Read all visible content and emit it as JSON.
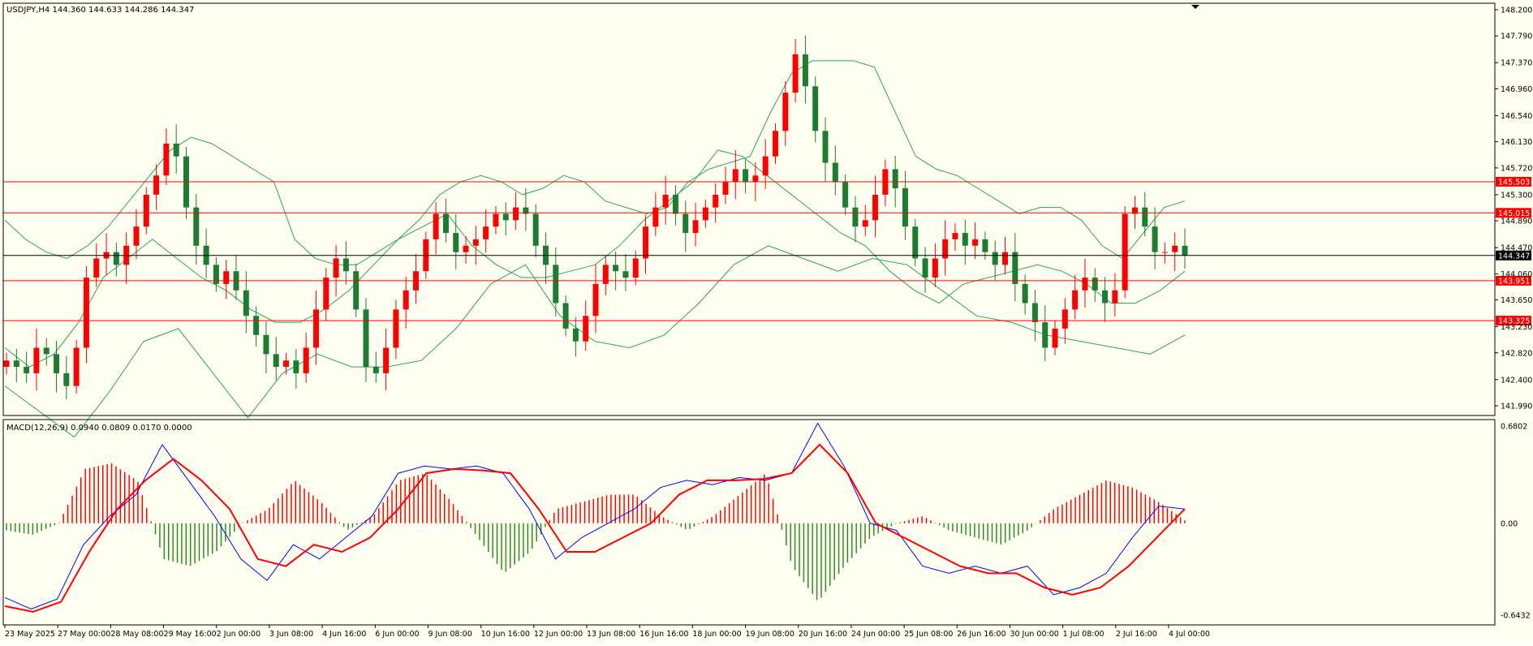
{
  "header": {
    "symbol_text": "USDJPY,H4  144.360 144.633 144.286 144.347",
    "macd_text": "MACD(12,26,9) 0.0940 0.0809 0.0170 0.0000"
  },
  "colors": {
    "background": "#fefff0",
    "bull": "#ff0000",
    "bear": "#1e7b32",
    "bollinger": "#2ca35a",
    "hline": "#ff0000",
    "current": "#000000",
    "macd_main": "#0000ff",
    "macd_signal": "#ff0000",
    "hist_up": "#ff0000",
    "hist_down": "#2e8b24"
  },
  "chart_data": [
    {
      "type": "candlestick",
      "symbol": "USDJPY",
      "timeframe": "H4",
      "ohlc_header": {
        "open": 144.36,
        "high": 144.633,
        "low": 144.286,
        "close": 144.347
      },
      "ylim": [
        141.99,
        148.2
      ],
      "y_ticks": [
        "148.200",
        "147.790",
        "147.370",
        "146.960",
        "146.540",
        "146.130",
        "145.720",
        "145.300",
        "144.890",
        "144.470",
        "144.060",
        "143.650",
        "143.230",
        "142.820",
        "142.400",
        "141.990"
      ],
      "x_ticks": [
        "23 May 2025",
        "27 May 00:00",
        "28 May 08:00",
        "29 May 16:00",
        "2 Jun 00:00",
        "3 Jun 08:00",
        "4 Jun 16:00",
        "6 Jun 00:00",
        "9 Jun 08:00",
        "10 Jun 16:00",
        "12 Jun 00:00",
        "13 Jun 08:00",
        "16 Jun 16:00",
        "18 Jun 00:00",
        "19 Jun 08:00",
        "20 Jun 16:00",
        "24 Jun 00:00",
        "25 Jun 08:00",
        "26 Jun 16:00",
        "30 Jun 00:00",
        "1 Jul 08:00",
        "2 Jul 16:00",
        "4 Jul 00:00"
      ],
      "close_path": [
        142.7,
        142.6,
        142.5,
        142.9,
        142.8,
        142.5,
        142.3,
        142.9,
        144.0,
        144.3,
        144.4,
        144.2,
        144.5,
        144.8,
        145.3,
        145.6,
        146.1,
        145.9,
        145.1,
        144.5,
        144.2,
        143.9,
        144.1,
        143.8,
        143.4,
        143.1,
        142.8,
        142.6,
        142.7,
        142.5,
        142.9,
        143.5,
        144.0,
        144.3,
        144.1,
        143.5,
        142.6,
        142.5,
        142.9,
        143.5,
        143.8,
        144.1,
        144.6,
        145.0,
        144.7,
        144.4,
        144.5,
        144.6,
        144.8,
        145.0,
        144.9,
        145.1,
        145.0,
        144.5,
        144.2,
        143.6,
        143.2,
        143.0,
        143.4,
        143.9,
        144.2,
        144.1,
        144.0,
        144.3,
        144.8,
        145.1,
        145.3,
        145.0,
        144.7,
        144.9,
        145.1,
        145.3,
        145.5,
        145.7,
        145.5,
        145.6,
        145.9,
        146.3,
        146.9,
        147.5,
        147.0,
        146.3,
        145.8,
        145.5,
        145.1,
        144.8,
        144.9,
        145.3,
        145.7,
        145.4,
        144.8,
        144.3,
        144.0,
        144.3,
        144.6,
        144.7,
        144.5,
        144.6,
        144.4,
        144.2,
        144.4,
        143.9,
        143.6,
        143.3,
        142.9,
        143.2,
        143.5,
        143.8,
        144.0,
        143.8,
        143.6,
        143.8,
        145.0,
        145.1,
        144.8,
        144.4,
        144.4,
        144.5,
        144.35
      ],
      "bollinger": {
        "upper": [
          144.9,
          144.6,
          144.4,
          144.3,
          144.5,
          144.8,
          145.2,
          145.6,
          146.0,
          146.2,
          146.1,
          145.9,
          145.7,
          145.5,
          144.6,
          144.3,
          144.2,
          144.2,
          144.4,
          144.6,
          144.9,
          145.3,
          145.5,
          145.6,
          145.5,
          145.3,
          145.4,
          145.6,
          145.5,
          145.2,
          145.1,
          145.0,
          145.1,
          145.5,
          145.7,
          145.8,
          145.9,
          146.6,
          147.2,
          147.4,
          147.4,
          147.4,
          147.3,
          146.6,
          145.9,
          145.7,
          145.6,
          145.4,
          145.2,
          145.0,
          145.1,
          145.1,
          144.9,
          144.5,
          144.3,
          144.7,
          145.1,
          145.2
        ],
        "middle": [
          142.9,
          142.6,
          142.8,
          143.3,
          144.0,
          144.3,
          144.6,
          144.3,
          144.0,
          143.8,
          143.5,
          143.3,
          143.3,
          143.5,
          143.8,
          144.2,
          144.6,
          144.8,
          145.0,
          144.5,
          144.2,
          144.0,
          144.0,
          144.1,
          144.2,
          144.5,
          144.9,
          145.2,
          145.5,
          146.0,
          145.9,
          145.6,
          145.3,
          145.0,
          144.7,
          144.5,
          144.1,
          143.8,
          143.6,
          143.9,
          144.0,
          144.1,
          144.2,
          144.1,
          143.9,
          143.6,
          143.6,
          143.8,
          144.1
        ],
        "lower": [
          142.3,
          141.9,
          141.5,
          142.2,
          143.0,
          143.2,
          142.5,
          141.8,
          142.5,
          142.8,
          142.6,
          142.6,
          142.7,
          143.2,
          143.9,
          144.2,
          143.4,
          143.0,
          142.9,
          143.1,
          143.6,
          144.2,
          144.5,
          144.3,
          144.1,
          144.3,
          144.2,
          143.8,
          143.4,
          143.3,
          143.1,
          143.0,
          142.9,
          142.8,
          143.1
        ]
      }
    },
    {
      "type": "macd",
      "name": "MACD(12,26,9)",
      "values": {
        "main": 0.094,
        "signal": 0.0809,
        "histogram": 0.017,
        "fourth": 0.0
      },
      "ylim": [
        -0.6432,
        0.6802
      ],
      "y_ticks": [
        "0.6802",
        "0.00",
        "-0.6432"
      ],
      "main_path": [
        -0.52,
        -0.6,
        -0.53,
        -0.15,
        0.05,
        0.2,
        0.55,
        0.3,
        0.05,
        -0.25,
        -0.4,
        -0.15,
        -0.25,
        -0.1,
        0.05,
        0.35,
        0.4,
        0.38,
        0.4,
        0.35,
        0.1,
        -0.25,
        -0.1,
        0.0,
        0.1,
        0.25,
        0.3,
        0.27,
        0.32,
        0.3,
        0.35,
        0.7,
        0.4,
        0.0,
        -0.05,
        -0.3,
        -0.35,
        -0.3,
        -0.35,
        -0.3,
        -0.5,
        -0.45,
        -0.35,
        -0.1,
        0.12,
        0.1
      ],
      "signal_path": [
        -0.58,
        -0.62,
        -0.55,
        -0.2,
        0.1,
        0.3,
        0.45,
        0.3,
        0.1,
        -0.25,
        -0.3,
        -0.15,
        -0.2,
        -0.1,
        0.1,
        0.35,
        0.38,
        0.37,
        0.35,
        0.1,
        -0.2,
        -0.2,
        -0.1,
        0.0,
        0.2,
        0.3,
        0.3,
        0.31,
        0.35,
        0.55,
        0.35,
        0.0,
        -0.1,
        -0.2,
        -0.3,
        -0.35,
        -0.35,
        -0.45,
        -0.5,
        -0.45,
        -0.3,
        -0.1,
        0.1
      ],
      "histogram_path": [
        -0.05,
        -0.08,
        0.0,
        0.38,
        0.42,
        0.3,
        -0.25,
        -0.3,
        -0.2,
        0.0,
        0.1,
        0.3,
        0.15,
        -0.05,
        0.05,
        0.3,
        0.35,
        0.15,
        -0.1,
        -0.35,
        -0.2,
        0.1,
        0.15,
        0.2,
        0.2,
        0.05,
        -0.05,
        0.05,
        0.2,
        0.35,
        -0.3,
        -0.55,
        -0.3,
        -0.1,
        0.0,
        0.05,
        -0.05,
        -0.1,
        -0.15,
        -0.05,
        0.1,
        0.2,
        0.3,
        0.25,
        0.15,
        0.02
      ]
    }
  ],
  "price_lines": [
    {
      "price": 145.503,
      "label": "145.503"
    },
    {
      "price": 145.015,
      "label": "145.015"
    },
    {
      "price": 143.951,
      "label": "143.951"
    },
    {
      "price": 143.325,
      "label": "143.325"
    }
  ],
  "current_price": {
    "price": 144.347,
    "label": "144.347"
  }
}
